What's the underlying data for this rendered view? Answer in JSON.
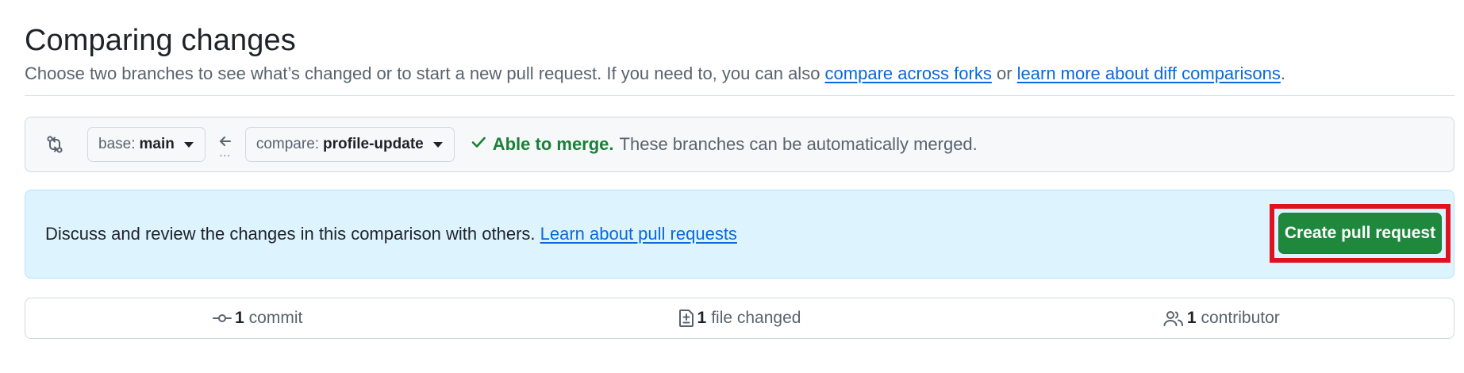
{
  "header": {
    "title": "Comparing changes",
    "subtitle_pre": "Choose two branches to see what’s changed or to start a new pull request. If you need to, you can also ",
    "link_forks": "compare across forks",
    "subtitle_mid": " or ",
    "link_diff": "learn more about diff comparisons",
    "subtitle_end": "."
  },
  "range": {
    "base_key": "base:",
    "base_value": "main",
    "compare_key": "compare:",
    "compare_value": "profile-update",
    "dots": "...",
    "merge_ok": "Able to merge.",
    "merge_desc": "These branches can be automatically merged."
  },
  "discuss": {
    "text": "Discuss and review the changes in this comparison with others. ",
    "link": "Learn about pull requests",
    "button": "Create pull request"
  },
  "stats": {
    "commits_count": "1",
    "commits_label": "commit",
    "files_count": "1",
    "files_label": "file changed",
    "contributors_count": "1",
    "contributors_label": "contributor"
  },
  "icons": {
    "compare": "git-compare-icon",
    "arrow": "arrow-left-icon",
    "check": "check-icon",
    "commit": "git-commit-icon",
    "file_diff": "file-diff-icon",
    "people": "people-icon"
  },
  "colors": {
    "link": "#0969da",
    "success": "#1a7f37",
    "primary_button": "#1f883d",
    "info_bg": "#ddf4ff",
    "highlight": "#e0121f"
  }
}
